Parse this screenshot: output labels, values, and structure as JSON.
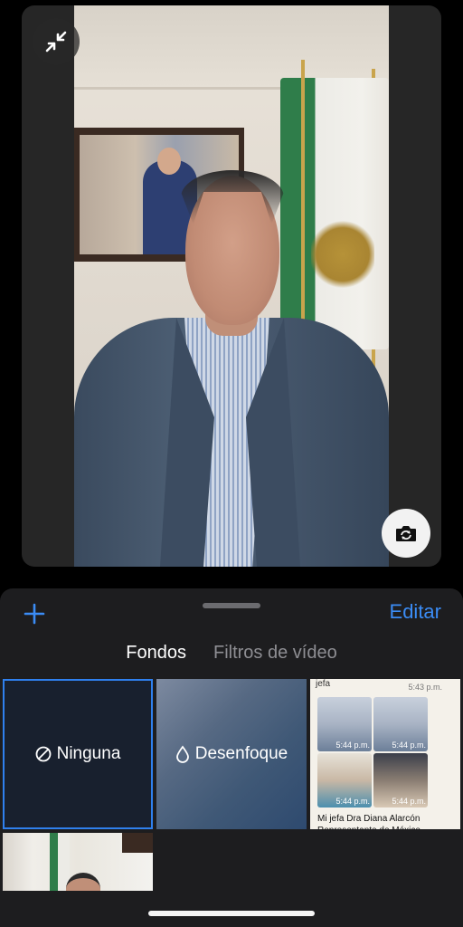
{
  "preview": {
    "collapse_icon": "collapse-arrows-icon",
    "flip_camera_icon": "camera-flip-icon"
  },
  "sheet": {
    "add_icon": "plus-icon",
    "edit_label": "Editar",
    "tabs": [
      {
        "label": "Fondos",
        "active": true
      },
      {
        "label": "Filtros de vídeo",
        "active": false
      }
    ],
    "tiles": {
      "none_label": "Ninguna",
      "blur_label": "Desenfoque",
      "chat": {
        "header": "jefa",
        "top_time": "5:43 p.m.",
        "image_times": [
          "5:44 p.m.",
          "5:44 p.m.",
          "5:44 p.m.",
          "5:44 p.m."
        ],
        "caption": "Mi jefa Dra Diana Alarcón Representante de México"
      }
    }
  },
  "colors": {
    "accent": "#3b8cf5",
    "sheet_bg": "#1d1d1f",
    "selected_border": "#2f80ed"
  }
}
